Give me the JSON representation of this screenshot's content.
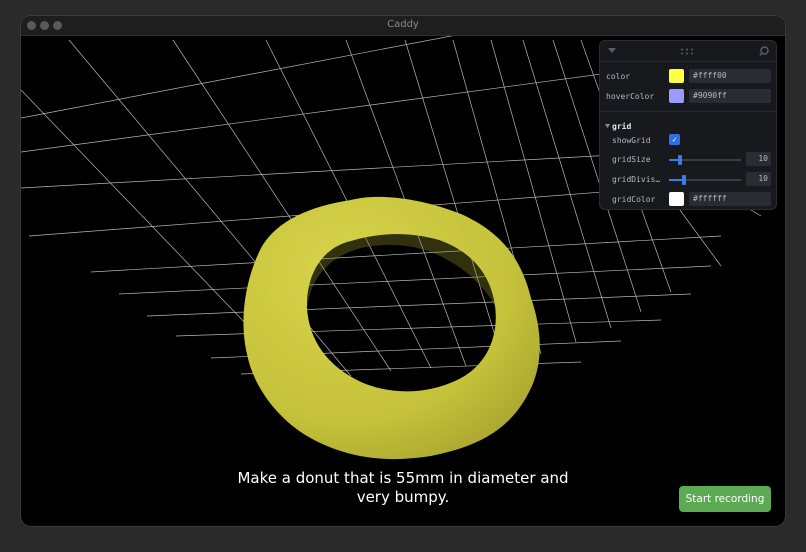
{
  "window": {
    "title": "Caddy"
  },
  "panel": {
    "rows": {
      "color": {
        "label": "color",
        "value": "#ffff00",
        "swatch": "#ffff44"
      },
      "hoverColor": {
        "label": "hoverColor",
        "value": "#9090ff",
        "swatch": "#9a9aff"
      }
    },
    "grid": {
      "title": "grid",
      "showGrid": {
        "label": "showGrid",
        "checked": true
      },
      "gridSize": {
        "label": "gridSize",
        "value": "10"
      },
      "gridDivisions": {
        "label": "gridDivis…",
        "value": "10"
      },
      "gridColor": {
        "label": "gridColor",
        "value": "#ffffff",
        "swatch": "#ffffff"
      }
    }
  },
  "prompt": {
    "text": "Make a donut that is 55mm in diameter and very bumpy."
  },
  "actions": {
    "start_recording": "Start recording"
  },
  "colors": {
    "donut": "#c9c63e",
    "background": "#000000",
    "grid": "#ffffff",
    "accent": "#3b7be6",
    "record": "#5cab54"
  }
}
